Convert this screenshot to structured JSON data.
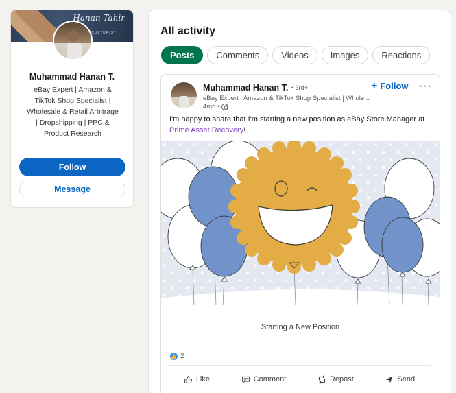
{
  "profile": {
    "banner_signature": "Hanan Tahir",
    "banner_subtitle": "HORTICULTURIST",
    "name": "Muhammad Hanan T.",
    "headline": "eBay Expert | Amazon & TikTok Shop Specialist | Wholesale & Retail Arbitrage | Dropshipping | PPC & Product Research",
    "follow_label": "Follow",
    "message_label": "Message"
  },
  "activity": {
    "title": "All activity",
    "tabs": [
      {
        "label": "Posts",
        "active": true
      },
      {
        "label": "Comments",
        "active": false
      },
      {
        "label": "Videos",
        "active": false
      },
      {
        "label": "Images",
        "active": false
      },
      {
        "label": "Reactions",
        "active": false
      }
    ]
  },
  "post": {
    "author": "Muhammad Hanan T.",
    "degree": "• 3rd+",
    "author_headline": "eBay Expert | Amazon & TikTok Shop Specialist | Whole...",
    "time": "4mo •",
    "follow_label": "Follow",
    "more_label": "···",
    "text_before": "I'm happy to share that I'm starting a new position as eBay Store Manager at ",
    "company": "Prime Asset Recovery",
    "text_after": "!",
    "caption": "Starting a New Position",
    "reaction_count": "2",
    "actions": {
      "like": "Like",
      "comment": "Comment",
      "repost": "Repost",
      "send": "Send"
    }
  },
  "colors": {
    "primary": "#0a66c2",
    "active_tab": "#01754f",
    "company_link": "#7a3fb5",
    "balloon_blue": "#7193c9",
    "sun": "#e3ac44"
  }
}
